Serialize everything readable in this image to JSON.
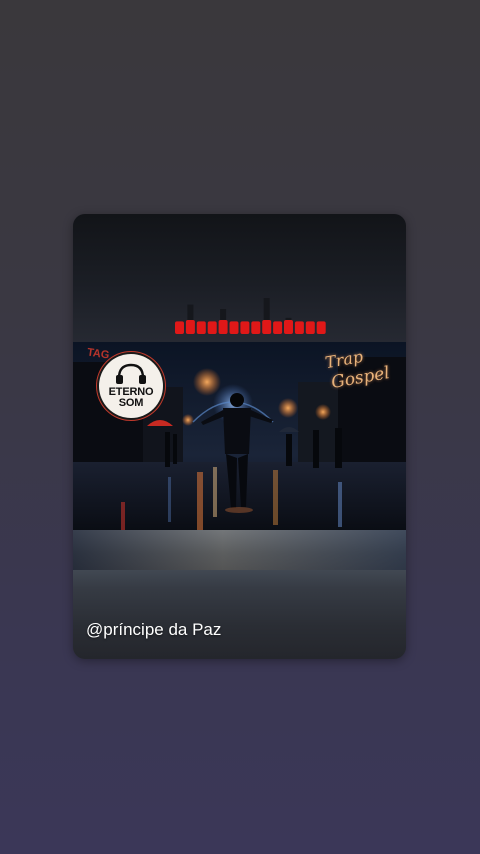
{
  "post": {
    "username": "@príncipe da Paz"
  },
  "cover": {
    "logo_line1": "ETERNO",
    "logo_line2": "SOM",
    "headphones_icon": "headphones-icon",
    "tag_left": "TAG",
    "genre_line1": "Trap",
    "genre_line2": "Gospel"
  },
  "visualizer": {
    "color_active": "#e01818",
    "color_dark": "#15171c",
    "levels": [
      0.9,
      1.6,
      0.9,
      0.9,
      1.4,
      0.9,
      0.9,
      0.9,
      1.9,
      0.9,
      1.0,
      0.9,
      0.9,
      0.9
    ]
  },
  "colors": {
    "background_top": "#3a383c",
    "background_bottom": "#3b3758",
    "text": "#ffffff"
  }
}
